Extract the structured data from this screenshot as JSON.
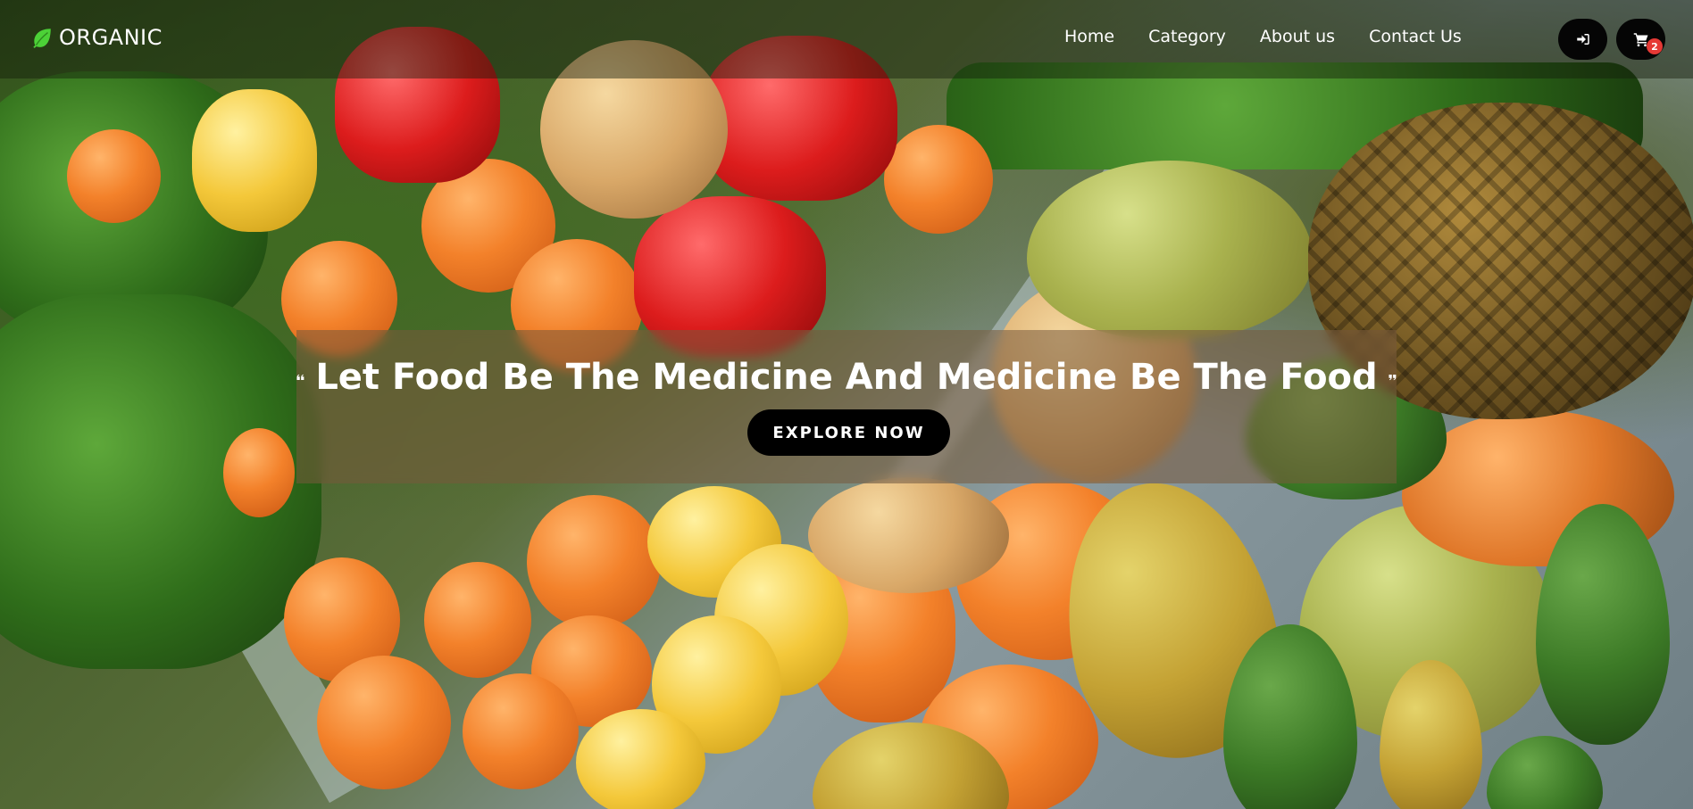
{
  "brand": {
    "name": "ORGANIC",
    "icon": "leaf-icon",
    "icon_color": "#4cd137"
  },
  "nav": {
    "links": [
      {
        "label": "Home"
      },
      {
        "label": "Category"
      },
      {
        "label": "About us"
      },
      {
        "label": "Contact Us"
      }
    ]
  },
  "actions": {
    "login_icon": "sign-in-icon",
    "cart_icon": "shopping-cart-icon",
    "cart_count": "2"
  },
  "hero": {
    "title": "Let Food Be The Medicine And Medicine Be The Food",
    "cta_label": "EXPLORE NOW",
    "open_quote_icon": "quote-left-icon",
    "close_quote_icon": "quote-right-icon"
  },
  "colors": {
    "badge": "#e53935",
    "button": "#000000",
    "text": "#ffffff"
  }
}
